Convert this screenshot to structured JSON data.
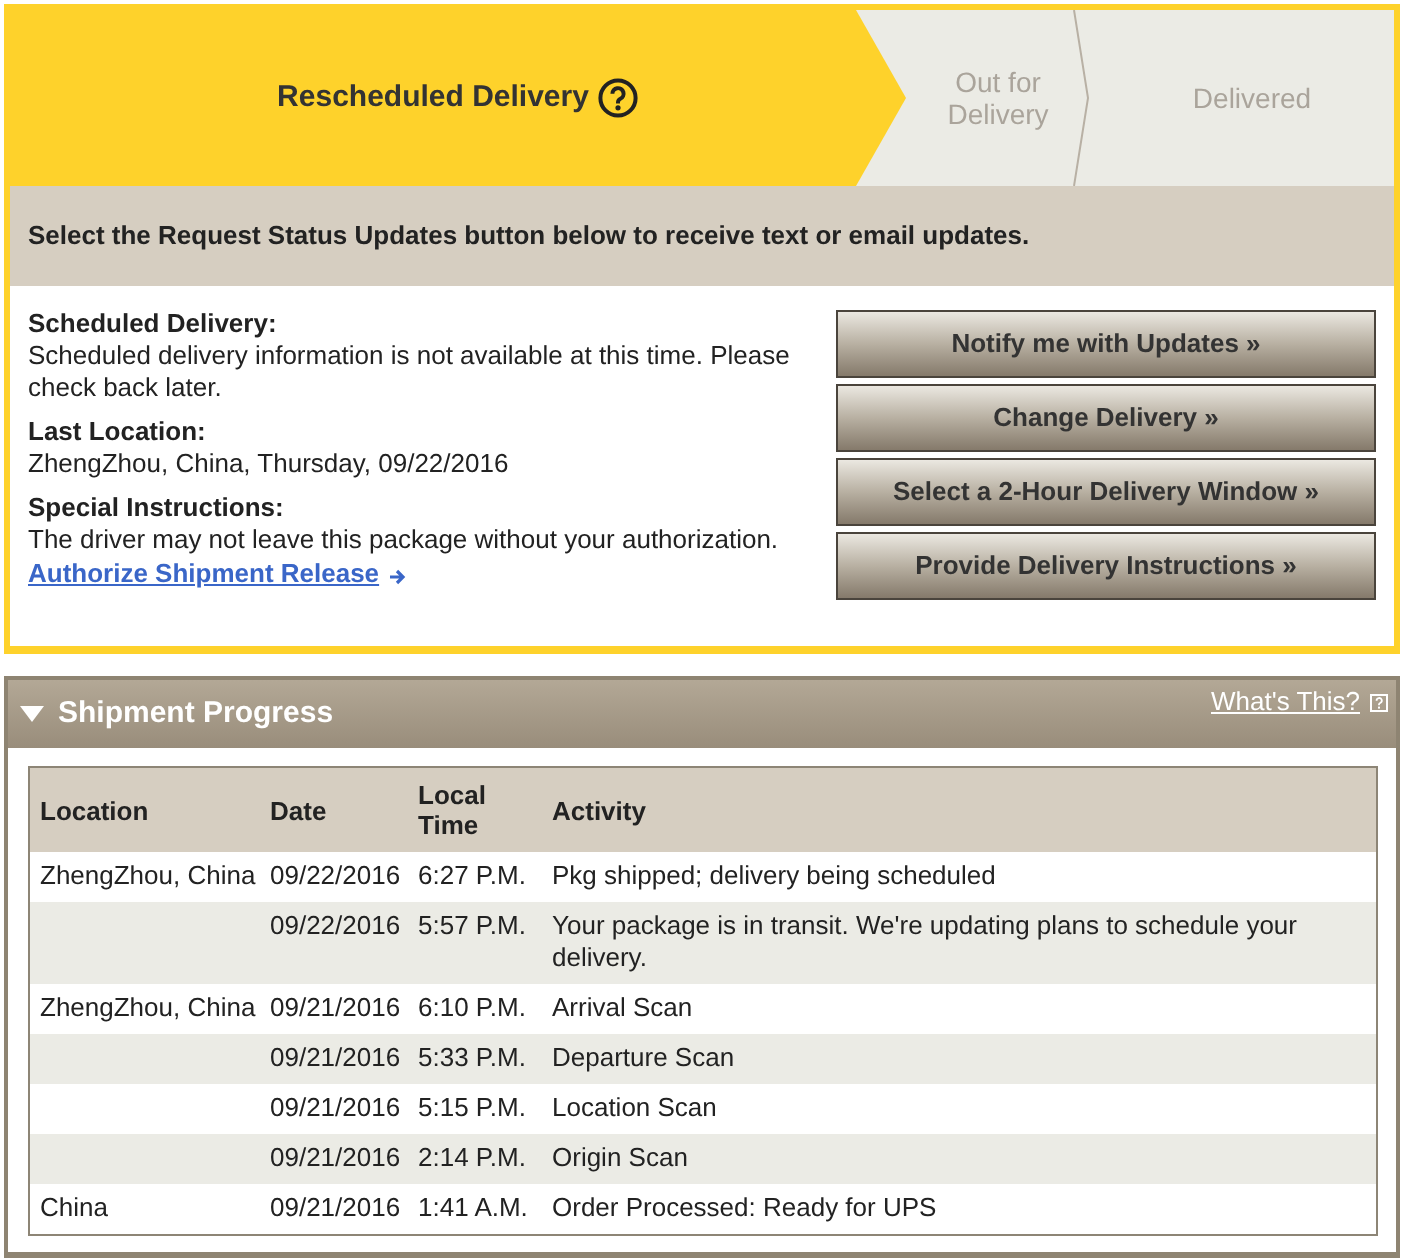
{
  "progress_steps": [
    {
      "label": "Rescheduled Delivery",
      "selected": true,
      "help": true
    },
    {
      "label": "Out for Delivery",
      "selected": false,
      "help": false
    },
    {
      "label": "Delivered",
      "selected": false,
      "help": false
    }
  ],
  "notice": "Select the Request Status Updates button below to receive text or email updates.",
  "details": [
    {
      "label": "Scheduled Delivery:",
      "text": "Scheduled delivery information is not available at this time. Please check back later."
    },
    {
      "label": "Last Location:",
      "text": "ZhengZhou, China, Thursday, 09/22/2016"
    },
    {
      "label": "Special Instructions:",
      "text": "The driver may not leave this package without your authorization.",
      "link": "Authorize Shipment Release"
    }
  ],
  "actions": [
    "Notify me with Updates »",
    "Change Delivery »",
    "Select a 2-Hour Delivery Window »",
    "Provide Delivery Instructions »"
  ],
  "shipment_progress": {
    "title": "Shipment Progress",
    "expanded": true,
    "help_link": "What's This?",
    "table": {
      "columns": [
        "Location",
        "Date",
        "Local Time",
        "Activity"
      ],
      "rows": [
        {
          "location": "ZhengZhou, China",
          "date": "09/22/2016",
          "time": "6:27 P.M.",
          "activity": "Pkg shipped; delivery being scheduled"
        },
        {
          "date": "09/22/2016",
          "time": "5:57 P.M.",
          "activity": "Your package is in transit. We're updating plans to schedule your delivery."
        },
        {
          "location": "ZhengZhou, China",
          "date": "09/21/2016",
          "time": "6:10 P.M.",
          "activity": "Arrival Scan"
        },
        {
          "date": "09/21/2016",
          "time": "5:33 P.M.",
          "activity": "Departure Scan"
        },
        {
          "date": "09/21/2016",
          "time": "5:15 P.M.",
          "activity": "Location Scan"
        },
        {
          "date": "09/21/2016",
          "time": "2:14 P.M.",
          "activity": "Origin Scan"
        },
        {
          "location": "China",
          "date": "09/21/2016",
          "time": "1:41 A.M.",
          "activity": "Order Processed: Ready for UPS"
        }
      ]
    }
  }
}
